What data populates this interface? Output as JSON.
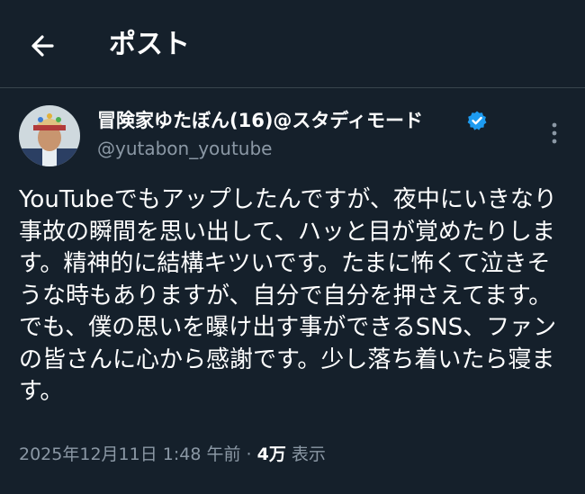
{
  "header": {
    "title": "ポスト",
    "back_icon": "arrow-left-icon"
  },
  "author": {
    "display_name": "冒険家ゆたぼん(16)@スタディモード",
    "handle": "@yutabon_youtube",
    "verified_color": "#1d9bf0"
  },
  "post": {
    "text": "YouTubeでもアップしたんですが、夜中にいきなり事故の瞬間を思い出して、ハッと目が覚めたりします。精神的に結構キツいです。たまに怖くて泣きそうな時もありますが、自分で自分を押さえてます。でも、僕の思いを曝け出す事ができるSNS、ファンの皆さんに心から感謝です。少し落ち着いたら寝ます。"
  },
  "meta": {
    "timestamp": "2025年12月11日 1:48 午前",
    "separator": "·",
    "views_count": "4万",
    "views_label": "表示"
  },
  "colors": {
    "background": "#15202b",
    "secondary_text": "#8b98a5",
    "divider": "#38444d"
  }
}
